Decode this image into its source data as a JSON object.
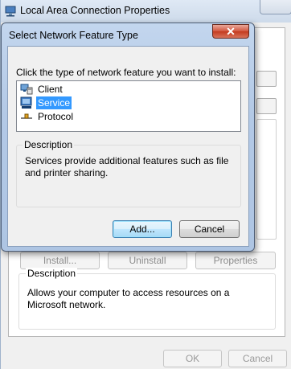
{
  "background_window": {
    "title": "Local Area Connection Properties",
    "buttons": {
      "install_label": "Install...",
      "uninstall_label": "Uninstall",
      "properties_label": "Properties"
    },
    "description": {
      "title": "Description",
      "text": "Allows your computer to access resources on a Microsoft network."
    },
    "footer": {
      "ok_label": "OK",
      "cancel_label": "Cancel"
    }
  },
  "dialog": {
    "title": "Select Network Feature Type",
    "close_label": "✕",
    "instruction": "Click the type of network feature you want to install:",
    "feature_types": [
      {
        "label": "Client",
        "icon": "client-icon",
        "selected": false
      },
      {
        "label": "Service",
        "icon": "service-icon",
        "selected": true
      },
      {
        "label": "Protocol",
        "icon": "protocol-icon",
        "selected": false
      }
    ],
    "description": {
      "title": "Description",
      "text": "Services provide additional features such as file and printer sharing."
    },
    "add_label": "Add...",
    "cancel_label": "Cancel"
  },
  "colors": {
    "selection": "#3399ff",
    "close_button": "#c33a1f",
    "frame": "#b3c9e6"
  }
}
